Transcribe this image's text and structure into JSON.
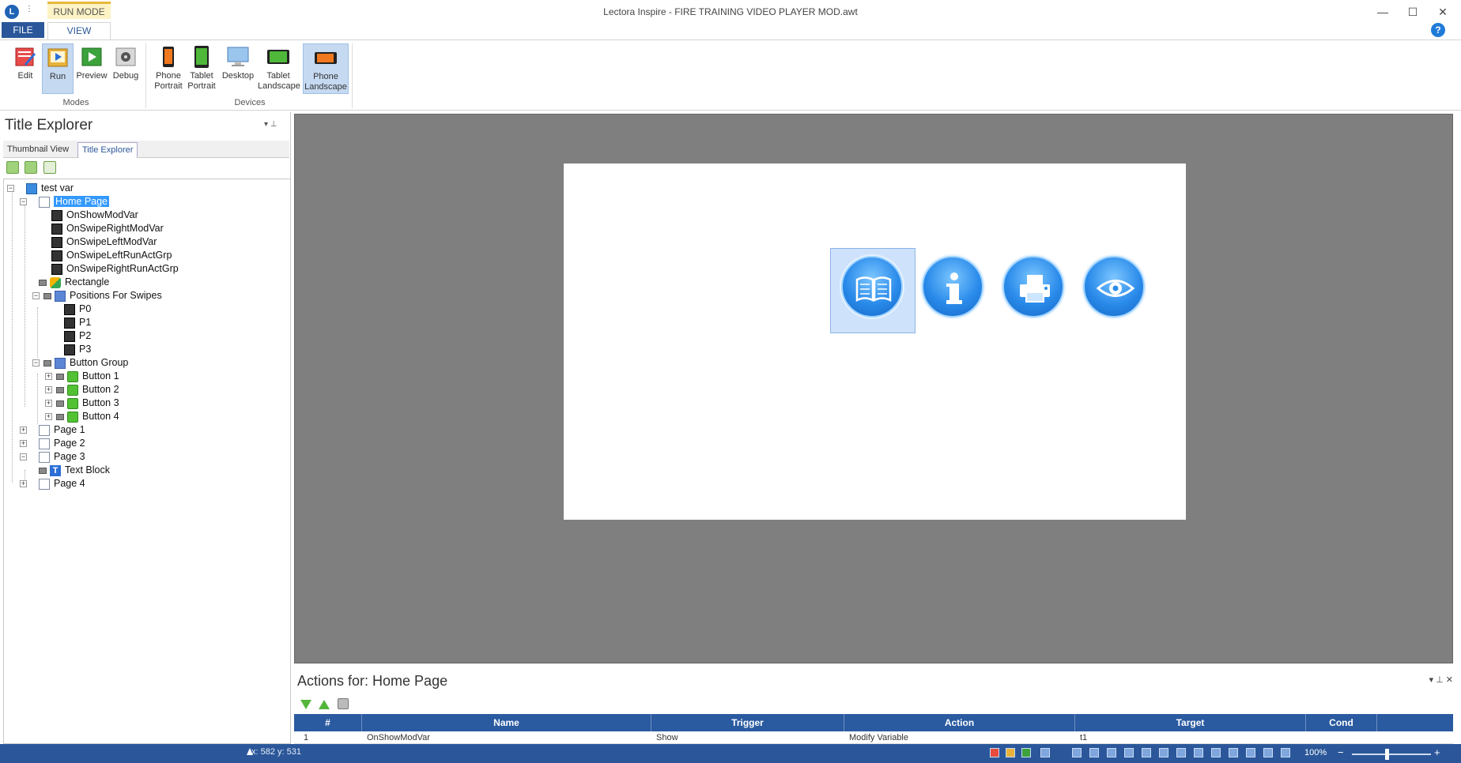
{
  "window": {
    "title": "Lectora Inspire - FIRE TRAINING VIDEO PLAYER MOD.awt",
    "app_icon": "L",
    "qat": "⋮",
    "contextual_tab": "RUN MODE",
    "minimize": "—",
    "maximize": "☐",
    "close": "✕"
  },
  "ribbon": {
    "tabs": {
      "file": "FILE",
      "view": "VIEW"
    },
    "help": "?",
    "modes": {
      "label": "Modes",
      "buttons": [
        {
          "label": "Edit"
        },
        {
          "label": "Run"
        },
        {
          "label": "Preview"
        },
        {
          "label": "Debug"
        }
      ]
    },
    "devices": {
      "label": "Devices",
      "buttons": [
        {
          "label1": "Phone",
          "label2": "Portrait"
        },
        {
          "label1": "Tablet",
          "label2": "Portrait"
        },
        {
          "label1": "Desktop",
          "label2": ""
        },
        {
          "label1": "Tablet",
          "label2": "Landscape"
        },
        {
          "label1": "Phone",
          "label2": "Landscape"
        }
      ]
    }
  },
  "explorer": {
    "title": "Title Explorer",
    "pin": "▾ ⊥",
    "tabs": [
      "Thumbnail View",
      "Title Explorer"
    ],
    "tree": {
      "root": "test var",
      "home_page": "Home Page",
      "actions": [
        "OnShowModVar",
        "OnSwipeRightModVar",
        "OnSwipeLeftModVar",
        "OnSwipeLeftRunActGrp",
        "OnSwipeRightRunActGrp"
      ],
      "rectangle": "Rectangle",
      "positions_group": "Positions For Swipes",
      "positions": [
        "P0",
        "P1",
        "P2",
        "P3"
      ],
      "button_group": "Button Group",
      "buttons": [
        "Button 1",
        "Button 2",
        "Button 3",
        "Button 4"
      ],
      "page1": "Page 1",
      "page2": "Page 2",
      "page3": "Page 3",
      "text_block": "Text Block",
      "page4": "Page 4"
    }
  },
  "canvas": {
    "icons": [
      "book-icon",
      "info-icon",
      "printer-icon",
      "eye-icon"
    ]
  },
  "actions_panel": {
    "title": "Actions for: Home Page",
    "controls": "▾ ⊥ ✕",
    "columns": [
      "#",
      "Name",
      "Trigger",
      "Action",
      "Target",
      "Cond"
    ],
    "first_row": {
      "num": "1",
      "name": "OnShowModVar",
      "trigger": "Show",
      "action": "Modify Variable",
      "target": "t1",
      "cond": ""
    }
  },
  "status": {
    "coords": "x: 582  y: 531",
    "zoom": "100%",
    "zoom_minus": "−",
    "zoom_plus": "+"
  }
}
